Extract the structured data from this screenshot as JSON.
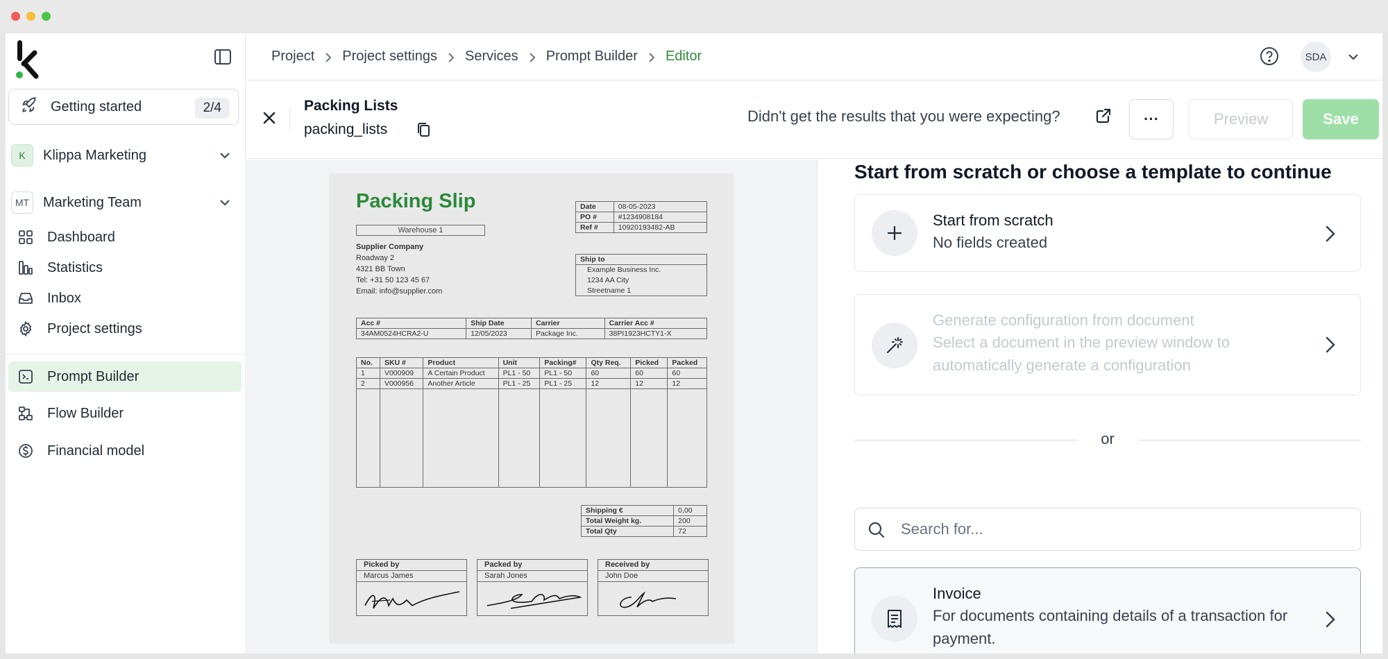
{
  "sidebar": {
    "getting_started": {
      "label": "Getting started",
      "count": "2/4"
    },
    "organization": {
      "badge": "K",
      "name": "Klippa Marketing"
    },
    "team": {
      "badge": "MT",
      "name": "Marketing Team"
    },
    "items": [
      {
        "label": "Dashboard",
        "icon": "grid-icon"
      },
      {
        "label": "Statistics",
        "icon": "bar-chart-icon"
      },
      {
        "label": "Inbox",
        "icon": "inbox-icon"
      },
      {
        "label": "Project settings",
        "icon": "gear-icon"
      },
      {
        "label": "Prompt Builder",
        "icon": "terminal-icon",
        "active": true
      },
      {
        "label": "Flow Builder",
        "icon": "flow-icon"
      },
      {
        "label": "Financial model",
        "icon": "dollar-circle-icon"
      }
    ]
  },
  "header": {
    "breadcrumb": [
      "Project",
      "Project settings",
      "Services",
      "Prompt Builder",
      "Editor"
    ],
    "avatar": "SDA"
  },
  "editor": {
    "title": "Packing Lists",
    "key": "packing_lists",
    "feedback": "Didn't get the results that you were expecting?",
    "more_label": "···",
    "preview_label": "Preview",
    "save_label": "Save"
  },
  "document": {
    "title": "Packing Slip",
    "warehouse": "Warehouse 1",
    "meta": [
      {
        "label": "Date",
        "value": "08-05-2023"
      },
      {
        "label": "PO #",
        "value": "#1234908184"
      },
      {
        "label": "Ref #",
        "value": "10920193482-AB"
      }
    ],
    "supplier": {
      "name": "Supplier Company",
      "lines": [
        "Roadway 2",
        "4321 BB Town",
        "Tel: +31 50 123 45 67",
        "Email: info@supplier.com"
      ]
    },
    "ship_to": {
      "label": "Ship to",
      "lines": [
        "Example Business Inc.",
        "1234 AA City",
        "Streetname 1"
      ]
    },
    "shipping": {
      "headers": [
        "Acc #",
        "Ship Date",
        "Carrier",
        "Carrier Acc #"
      ],
      "values": [
        "34AM0524HCRA2-U",
        "12/05/2023",
        "Package Inc.",
        "38PI1923HCTY1-X"
      ]
    },
    "items": {
      "headers": [
        "No.",
        "SKU #",
        "Product",
        "Unit",
        "Packing#",
        "Qty Req.",
        "Picked",
        "Packed"
      ],
      "rows": [
        [
          "1",
          "V000909",
          "A Certain Product",
          "PL1 - 50",
          "PL1 - 50",
          "60",
          "60",
          "60"
        ],
        [
          "2",
          "V000956",
          "Another Article",
          "PL1 - 25",
          "PL1 - 25",
          "12",
          "12",
          "12"
        ]
      ]
    },
    "totals": [
      {
        "label": "Shipping €",
        "value": "0,00"
      },
      {
        "label": "Total Weight kg.",
        "value": "200"
      },
      {
        "label": "Total Qty",
        "value": "72"
      }
    ],
    "signatures": [
      {
        "label": "Picked by",
        "name": "Marcus James"
      },
      {
        "label": "Packed by",
        "name": "Sarah Jones"
      },
      {
        "label": "Received by",
        "name": "John Doe"
      }
    ]
  },
  "panel": {
    "title": "Start from scratch or choose a template to continue",
    "scratch": {
      "title": "Start from scratch",
      "desc": "No fields created"
    },
    "generate": {
      "title": "Generate configuration from document",
      "desc": "Select a document in the preview window to automatically generate a configuration"
    },
    "or": "or",
    "search_placeholder": "Search for...",
    "invoice": {
      "title": "Invoice",
      "desc": "For documents containing details of a transaction for payment."
    }
  },
  "colors": {
    "accent": "#2e8b3a",
    "active_nav": "#e6f4e8",
    "save_disabled": "#9ddfa7"
  }
}
